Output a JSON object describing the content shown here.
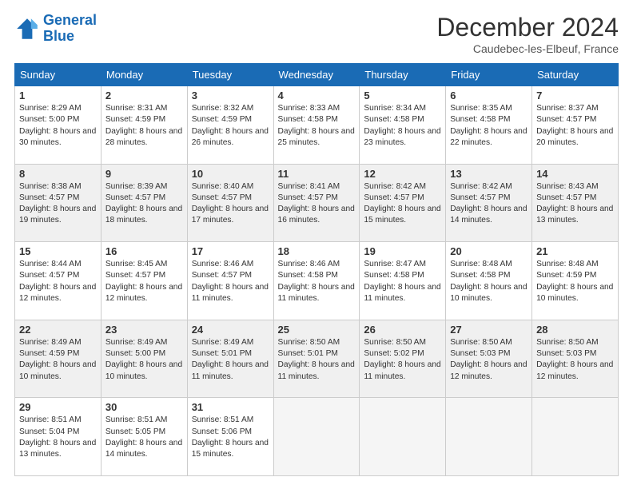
{
  "header": {
    "logo_line1": "General",
    "logo_line2": "Blue",
    "month_year": "December 2024",
    "location": "Caudebec-les-Elbeuf, France"
  },
  "days_of_week": [
    "Sunday",
    "Monday",
    "Tuesday",
    "Wednesday",
    "Thursday",
    "Friday",
    "Saturday"
  ],
  "weeks": [
    [
      {
        "num": "1",
        "sunrise": "Sunrise: 8:29 AM",
        "sunset": "Sunset: 5:00 PM",
        "daylight": "Daylight: 8 hours and 30 minutes."
      },
      {
        "num": "2",
        "sunrise": "Sunrise: 8:31 AM",
        "sunset": "Sunset: 4:59 PM",
        "daylight": "Daylight: 8 hours and 28 minutes."
      },
      {
        "num": "3",
        "sunrise": "Sunrise: 8:32 AM",
        "sunset": "Sunset: 4:59 PM",
        "daylight": "Daylight: 8 hours and 26 minutes."
      },
      {
        "num": "4",
        "sunrise": "Sunrise: 8:33 AM",
        "sunset": "Sunset: 4:58 PM",
        "daylight": "Daylight: 8 hours and 25 minutes."
      },
      {
        "num": "5",
        "sunrise": "Sunrise: 8:34 AM",
        "sunset": "Sunset: 4:58 PM",
        "daylight": "Daylight: 8 hours and 23 minutes."
      },
      {
        "num": "6",
        "sunrise": "Sunrise: 8:35 AM",
        "sunset": "Sunset: 4:58 PM",
        "daylight": "Daylight: 8 hours and 22 minutes."
      },
      {
        "num": "7",
        "sunrise": "Sunrise: 8:37 AM",
        "sunset": "Sunset: 4:57 PM",
        "daylight": "Daylight: 8 hours and 20 minutes."
      }
    ],
    [
      {
        "num": "8",
        "sunrise": "Sunrise: 8:38 AM",
        "sunset": "Sunset: 4:57 PM",
        "daylight": "Daylight: 8 hours and 19 minutes."
      },
      {
        "num": "9",
        "sunrise": "Sunrise: 8:39 AM",
        "sunset": "Sunset: 4:57 PM",
        "daylight": "Daylight: 8 hours and 18 minutes."
      },
      {
        "num": "10",
        "sunrise": "Sunrise: 8:40 AM",
        "sunset": "Sunset: 4:57 PM",
        "daylight": "Daylight: 8 hours and 17 minutes."
      },
      {
        "num": "11",
        "sunrise": "Sunrise: 8:41 AM",
        "sunset": "Sunset: 4:57 PM",
        "daylight": "Daylight: 8 hours and 16 minutes."
      },
      {
        "num": "12",
        "sunrise": "Sunrise: 8:42 AM",
        "sunset": "Sunset: 4:57 PM",
        "daylight": "Daylight: 8 hours and 15 minutes."
      },
      {
        "num": "13",
        "sunrise": "Sunrise: 8:42 AM",
        "sunset": "Sunset: 4:57 PM",
        "daylight": "Daylight: 8 hours and 14 minutes."
      },
      {
        "num": "14",
        "sunrise": "Sunrise: 8:43 AM",
        "sunset": "Sunset: 4:57 PM",
        "daylight": "Daylight: 8 hours and 13 minutes."
      }
    ],
    [
      {
        "num": "15",
        "sunrise": "Sunrise: 8:44 AM",
        "sunset": "Sunset: 4:57 PM",
        "daylight": "Daylight: 8 hours and 12 minutes."
      },
      {
        "num": "16",
        "sunrise": "Sunrise: 8:45 AM",
        "sunset": "Sunset: 4:57 PM",
        "daylight": "Daylight: 8 hours and 12 minutes."
      },
      {
        "num": "17",
        "sunrise": "Sunrise: 8:46 AM",
        "sunset": "Sunset: 4:57 PM",
        "daylight": "Daylight: 8 hours and 11 minutes."
      },
      {
        "num": "18",
        "sunrise": "Sunrise: 8:46 AM",
        "sunset": "Sunset: 4:58 PM",
        "daylight": "Daylight: 8 hours and 11 minutes."
      },
      {
        "num": "19",
        "sunrise": "Sunrise: 8:47 AM",
        "sunset": "Sunset: 4:58 PM",
        "daylight": "Daylight: 8 hours and 11 minutes."
      },
      {
        "num": "20",
        "sunrise": "Sunrise: 8:48 AM",
        "sunset": "Sunset: 4:58 PM",
        "daylight": "Daylight: 8 hours and 10 minutes."
      },
      {
        "num": "21",
        "sunrise": "Sunrise: 8:48 AM",
        "sunset": "Sunset: 4:59 PM",
        "daylight": "Daylight: 8 hours and 10 minutes."
      }
    ],
    [
      {
        "num": "22",
        "sunrise": "Sunrise: 8:49 AM",
        "sunset": "Sunset: 4:59 PM",
        "daylight": "Daylight: 8 hours and 10 minutes."
      },
      {
        "num": "23",
        "sunrise": "Sunrise: 8:49 AM",
        "sunset": "Sunset: 5:00 PM",
        "daylight": "Daylight: 8 hours and 10 minutes."
      },
      {
        "num": "24",
        "sunrise": "Sunrise: 8:49 AM",
        "sunset": "Sunset: 5:01 PM",
        "daylight": "Daylight: 8 hours and 11 minutes."
      },
      {
        "num": "25",
        "sunrise": "Sunrise: 8:50 AM",
        "sunset": "Sunset: 5:01 PM",
        "daylight": "Daylight: 8 hours and 11 minutes."
      },
      {
        "num": "26",
        "sunrise": "Sunrise: 8:50 AM",
        "sunset": "Sunset: 5:02 PM",
        "daylight": "Daylight: 8 hours and 11 minutes."
      },
      {
        "num": "27",
        "sunrise": "Sunrise: 8:50 AM",
        "sunset": "Sunset: 5:03 PM",
        "daylight": "Daylight: 8 hours and 12 minutes."
      },
      {
        "num": "28",
        "sunrise": "Sunrise: 8:50 AM",
        "sunset": "Sunset: 5:03 PM",
        "daylight": "Daylight: 8 hours and 12 minutes."
      }
    ],
    [
      {
        "num": "29",
        "sunrise": "Sunrise: 8:51 AM",
        "sunset": "Sunset: 5:04 PM",
        "daylight": "Daylight: 8 hours and 13 minutes."
      },
      {
        "num": "30",
        "sunrise": "Sunrise: 8:51 AM",
        "sunset": "Sunset: 5:05 PM",
        "daylight": "Daylight: 8 hours and 14 minutes."
      },
      {
        "num": "31",
        "sunrise": "Sunrise: 8:51 AM",
        "sunset": "Sunset: 5:06 PM",
        "daylight": "Daylight: 8 hours and 15 minutes."
      },
      null,
      null,
      null,
      null
    ]
  ]
}
